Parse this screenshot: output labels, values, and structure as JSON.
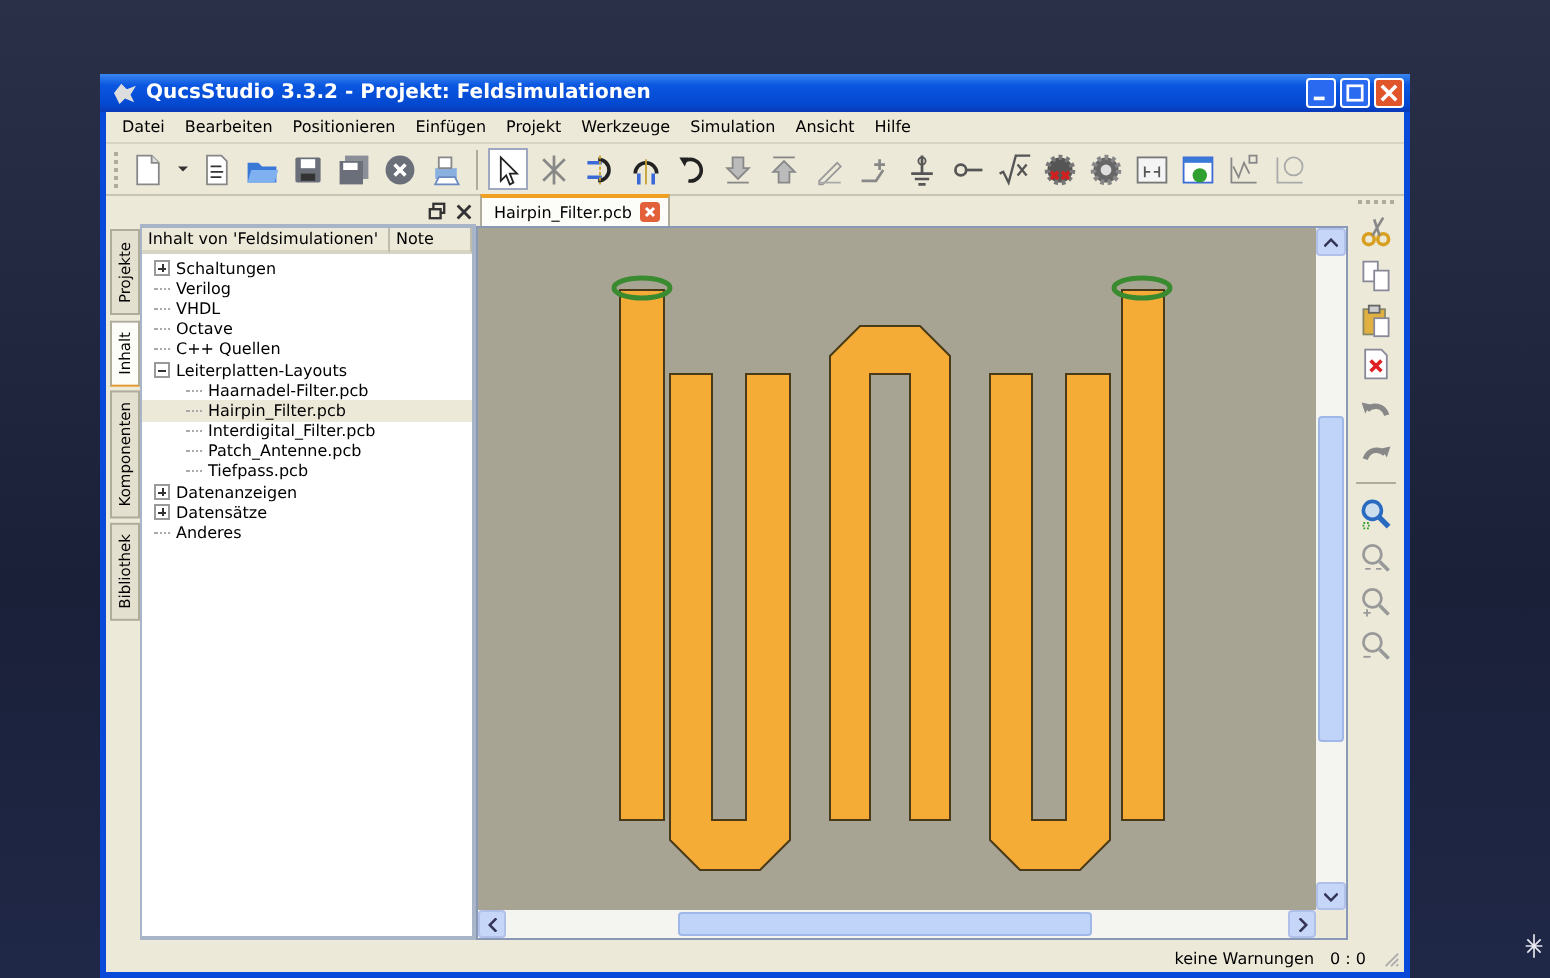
{
  "window": {
    "title": "QucsStudio 3.3.2 - Projekt: Feldsimulationen"
  },
  "menu": [
    "Datei",
    "Bearbeiten",
    "Positionieren",
    "Einfügen",
    "Projekt",
    "Werkzeuge",
    "Simulation",
    "Ansicht",
    "Hilfe"
  ],
  "toolbar": [
    {
      "kind": "new"
    },
    {
      "kind": "dropdown"
    },
    {
      "kind": "text"
    },
    {
      "kind": "open"
    },
    {
      "kind": "save"
    },
    {
      "kind": "saveall"
    },
    {
      "kind": "close"
    },
    {
      "kind": "print"
    },
    {
      "kind": "separator"
    },
    {
      "kind": "select",
      "selected": true
    },
    {
      "kind": "delete",
      "selected": false
    },
    {
      "kind": "mirrorx",
      "selected": false
    },
    {
      "kind": "mirrory",
      "selected": false
    },
    {
      "kind": "rotate",
      "selected": false
    },
    {
      "kind": "down",
      "selected": false
    },
    {
      "kind": "up",
      "selected": false
    },
    {
      "kind": "pencil",
      "selected": false
    },
    {
      "kind": "label",
      "selected": false
    },
    {
      "kind": "ground",
      "selected": false
    },
    {
      "kind": "port",
      "selected": false
    },
    {
      "kind": "equation",
      "selected": false
    },
    {
      "kind": "simulate"
    },
    {
      "kind": "gear"
    },
    {
      "kind": "matrix"
    },
    {
      "kind": "display"
    },
    {
      "kind": "marker",
      "selected": false
    },
    {
      "kind": "dot",
      "selected": false
    }
  ],
  "dock": {
    "side_tabs": [
      {
        "label": "Projekte",
        "selected": false
      },
      {
        "label": "Inhalt",
        "selected": true
      },
      {
        "label": "Komponenten",
        "selected": false
      },
      {
        "label": "Bibliothek",
        "selected": false
      }
    ],
    "columns": [
      "Inhalt von 'Feldsimulationen'",
      "Note"
    ],
    "tree": [
      {
        "label": "Schaltungen",
        "expanded": false,
        "selected": false
      },
      {
        "label": "Verilog",
        "selected": false
      },
      {
        "label": "VHDL",
        "selected": false
      },
      {
        "label": "Octave",
        "selected": false
      },
      {
        "label": "C++ Quellen",
        "selected": false
      },
      {
        "label": "Leiterplatten-Layouts",
        "expanded": true,
        "selected": false,
        "children": [
          {
            "label": "Haarnadel-Filter.pcb",
            "selected": false
          },
          {
            "label": "Hairpin_Filter.pcb",
            "selected": true
          },
          {
            "label": "Interdigital_Filter.pcb",
            "selected": false
          },
          {
            "label": "Patch_Antenne.pcb",
            "selected": false
          },
          {
            "label": "Tiefpass.pcb",
            "selected": false
          }
        ]
      },
      {
        "label": "Datenanzeigen",
        "expanded": false,
        "selected": false
      },
      {
        "label": "Datensätze",
        "expanded": false,
        "selected": false
      },
      {
        "label": "Anderes",
        "selected": false
      }
    ]
  },
  "document_tabs": [
    {
      "label": "Hairpin_Filter.pcb",
      "selected": true
    }
  ],
  "side_toolbar": [
    {
      "kind": "cut"
    },
    {
      "kind": "copy"
    },
    {
      "kind": "paste"
    },
    {
      "kind": "deletefile"
    },
    {
      "kind": "undo"
    },
    {
      "kind": "redo"
    },
    {
      "kind": "separator"
    },
    {
      "kind": "zoomarea"
    },
    {
      "kind": "zoom1"
    },
    {
      "kind": "zoomin"
    },
    {
      "kind": "zoomout"
    }
  ],
  "status_bar": {
    "message": "keine Warnungen",
    "counter": "0 : 0"
  }
}
